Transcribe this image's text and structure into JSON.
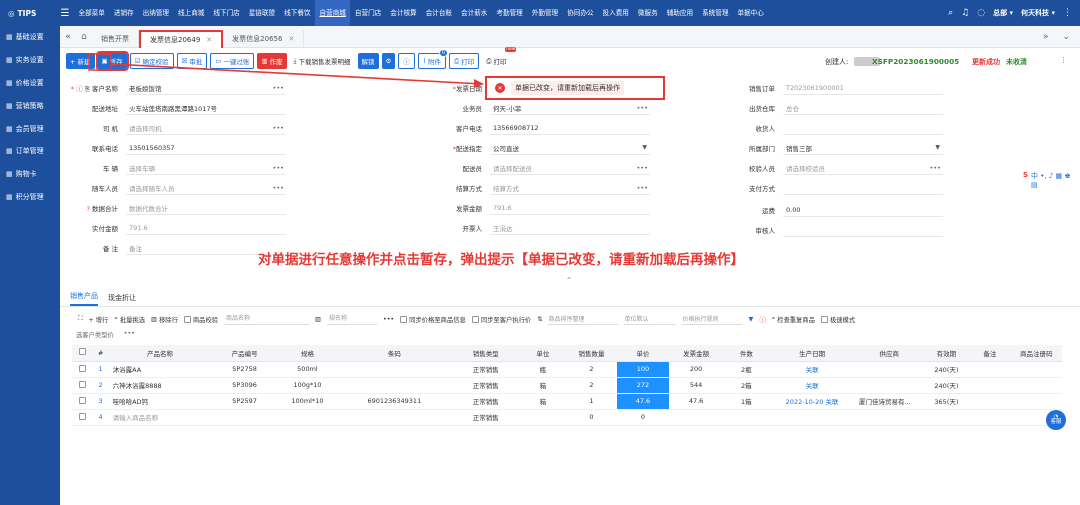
{
  "topnav": {
    "brand": "TIPS",
    "items": [
      "全部菜单",
      "进销存",
      "出纳管理",
      "线上商城",
      "线下门店",
      "星链联盟",
      "线下餐饮",
      "自营商城",
      "自营门店",
      "会计核算",
      "会计台账",
      "会计薪水",
      "考勤管理",
      "外勤管理",
      "协同办公",
      "投入费用",
      "微服务",
      "辅助应用",
      "系统管理",
      "单据中心"
    ],
    "active_index": 7,
    "user": "总部 ▾",
    "company": "何天科技 ▾"
  },
  "sidebar": {
    "items": [
      "基础设置",
      "实务设置",
      "价格设置",
      "营销策略",
      "会员管理",
      "订单管理",
      "购物卡",
      "积分管理"
    ]
  },
  "tabs": {
    "items": [
      "销售开票",
      "发票信息20649",
      "发票信息20656"
    ],
    "active_index": 1
  },
  "toolbar": {
    "new": "+ 新建",
    "save_draft": "暂存",
    "confirm_check": "确定校验",
    "audit": "审批",
    "one_click": "一键过账",
    "void": "作废",
    "download": "下载销售发票明细",
    "unlock": "解锁",
    "attach": "附件",
    "attach_count": "0",
    "print": "打印",
    "print2": "打印",
    "new_badge": "new"
  },
  "header": {
    "creator_label": "创建人:",
    "doc_no": "XSFP2023061900005",
    "update_status": "更新成功",
    "invoice_status": "未收清"
  },
  "alert": {
    "message": "单据已改变，请重新加载后再操作"
  },
  "caption": "对单据进行任意操作并点击暂存，弹出提示【单据已改变，请重新加载后再操作】",
  "form": {
    "customer_label": "客户名称",
    "customer_value": "老板娘饭馆",
    "addr_label": "配送地址",
    "addr_value": "火车站莲塔南路黑潭路1017号",
    "driver_label": "司 机",
    "driver_ph": "请选择司机",
    "phone_label": "联系电话",
    "phone_value": "13501560357",
    "car_label": "车 辆",
    "car_ph": "选择车辆",
    "follow_label": "随车人员",
    "follow_ph": "请选择随车人员",
    "total_label": "数据合计",
    "total_ph": "数据代数合计",
    "actual_label": "实付金额",
    "actual_value": "791.6",
    "remark_label": "备 注",
    "remark_ph": "备注",
    "invdate_label": "发票日期",
    "sales_label": "业务员",
    "sales_value": "何天-小菲",
    "cphone_label": "客户电话",
    "cphone_value": "13566908712",
    "ship_label": "配送指定",
    "ship_value": "公司直送",
    "deliver_label": "配送员",
    "deliver_ph": "请选择配送员",
    "settle_label": "结算方式",
    "settle_ph": "结算方式",
    "invamt_label": "发票金额",
    "invamt_value": "791.6",
    "issuer_label": "开票人",
    "issuer_value": "王涓达",
    "order_label": "销售订单",
    "order_value": "T2023061900001",
    "wh_label": "出货仓库",
    "wh_value": "总仓",
    "receiver_label": "收货人",
    "dept_label": "所属部门",
    "dept_value": "销售三部",
    "checker_label": "校验人员",
    "checker_ph": "请选择校验员",
    "pay_label": "支付方式",
    "freight_label": "运费",
    "freight_value": "0.00",
    "auditor_label": "审核人"
  },
  "ime": {
    "logo": "S",
    "chars": "中 •, ♪ ▦ ♚ ▤"
  },
  "subtabs": [
    "销售产品",
    "现金折让"
  ],
  "gridbar": {
    "add_row": "+ 增行",
    "batch": "批量挑选",
    "del_row": "移除行",
    "check": "商品校验",
    "name_ph": "商品名称",
    "series_ph": "规名称",
    "sync_info": "同步价格至商品信息",
    "sync_cust": "同步至客户执行价",
    "sort_ph": "商品排序整理",
    "unit_ph": "单位默认",
    "price_ph": "价格执行规则",
    "check_repeat": "检查重复商品",
    "pole": "极速模式",
    "type_ph": "选客户类型价",
    "more": "•••"
  },
  "grid": {
    "headers": [
      "#",
      "产品名称",
      "产品编号",
      "规格",
      "条码",
      "销售类型",
      "单位",
      "销售数量",
      "单价",
      "发票金额",
      "件数",
      "生产日期",
      "供应商",
      "有效期",
      "备注",
      "商品注册码"
    ],
    "rows": [
      [
        "1",
        "沐浴露AA",
        "SP2758",
        "500ml",
        "",
        "正常销售",
        "瓶",
        "2",
        "100",
        "200",
        "2瓶",
        "关联",
        "",
        "240(天)",
        "",
        ""
      ],
      [
        "2",
        "六神沐浴露8888",
        "SP3096",
        "100g*10",
        "",
        "正常销售",
        "箱",
        "2",
        "272",
        "544",
        "2箱",
        "关联",
        "",
        "240(天)",
        "",
        ""
      ],
      [
        "3",
        "哇哈哈AD钙",
        "SP2597",
        "100ml*10",
        "6901236349311",
        "正常销售",
        "箱",
        "1",
        "47.6",
        "47.6",
        "1箱",
        "2022-10-20  关联",
        "厦门佳诗贸易有...",
        "365(天)",
        "",
        ""
      ],
      [
        "4",
        "请输入商品名称",
        "",
        "",
        "",
        "正常销售",
        "",
        "0",
        "0",
        "",
        "",
        "",
        "",
        "",
        "",
        ""
      ]
    ]
  },
  "chat": {
    "label": "客服"
  }
}
